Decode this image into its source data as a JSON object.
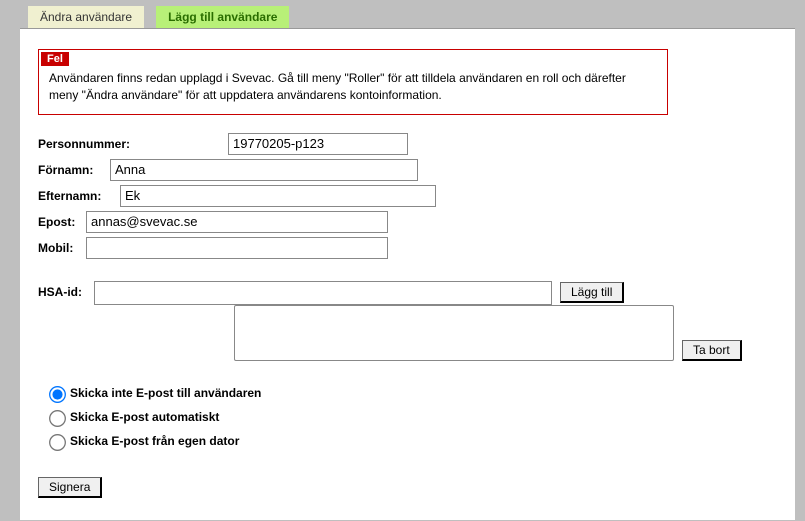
{
  "tabs": {
    "edit": "Ändra användare",
    "add": "Lägg till användare"
  },
  "error": {
    "badge": "Fel",
    "message": "Användaren finns redan upplagd i Svevac. Gå till meny \"Roller\" för att tilldela användaren en roll och därefter meny \"Ändra användare\" för att uppdatera användarens kontoinformation."
  },
  "fields": {
    "personnummer": {
      "label": "Personnummer:",
      "value": "19770205-p123"
    },
    "fornamn": {
      "label": "Förnamn:",
      "value": "Anna"
    },
    "efternamn": {
      "label": "Efternamn:",
      "value": "Ek"
    },
    "epost": {
      "label": "Epost:",
      "value": "annas@svevac.se"
    },
    "mobil": {
      "label": "Mobil:",
      "value": ""
    },
    "hsa": {
      "label": "HSA-id:",
      "value": ""
    }
  },
  "buttons": {
    "add": "Lägg till",
    "remove": "Ta bort",
    "signera": "Signera"
  },
  "radios": {
    "no_email": "Skicka inte E-post till användaren",
    "auto_email": "Skicka E-post automatiskt",
    "own_email": "Skicka E-post från egen dator"
  }
}
